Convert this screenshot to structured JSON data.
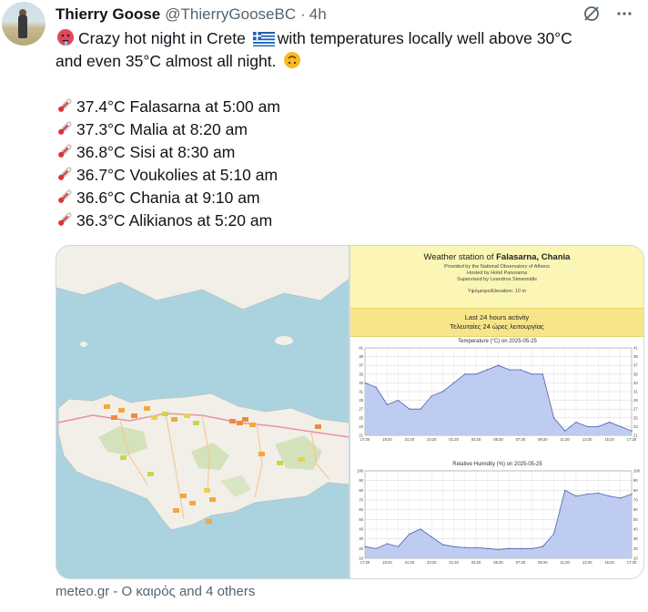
{
  "tweet": {
    "author_name": "Thierry Goose",
    "handle": "@ThierryGooseBC",
    "separator": "·",
    "time": "4h",
    "intro_line1": "Crazy hot night in Crete",
    "intro_line1b": "with temperatures locally well above 30°C",
    "intro_line2": "and even 35°C almost all night.",
    "readings": [
      "37.4°C Falasarna at 5:00 am",
      "37.3°C Malia at 8:20 am",
      "36.8°C Sisi at 8:30 am",
      "36.7°C Voukolies at 5:10 am",
      "36.6°C Chania at 9:10 am",
      "36.3°C Alikianos at 5:20 am"
    ],
    "footer": "meteo.gr - Ο καιρός and 4 others"
  },
  "icons": {
    "hot_face": "hot-face-emoji",
    "flag": "greece-flag-emoji",
    "upside_down": "upside-down-face-emoji",
    "thermometer": "thermometer-emoji",
    "grok": "grok-icon",
    "more": "more-icon"
  },
  "station": {
    "title_prefix": "Weather station of",
    "title_name": "Falasarna, Chania",
    "provided": "Provided by the National Observatory of Athens",
    "hosted": "Hosted by Hotel Panorama",
    "supervised": "Supervised by Leandros Simeonidis",
    "elevation": "Υψόμετρο/Elevation: 10 m",
    "last24_en": "Last 24 hours activity",
    "last24_gr": "Τελευταίες 24 ώρες λειτουργίας"
  },
  "colors": {
    "chart_fill": "#b8c6ef",
    "chart_line": "#4a5fae",
    "map_sea": "#aad3df",
    "map_land": "#f2efe9"
  },
  "chart_data": [
    {
      "type": "area",
      "title": "Temperature (°C) on 2025-05-25",
      "x": [
        "17:20",
        "18:20",
        "19:20",
        "20:20",
        "21:20",
        "22:20",
        "23:20",
        "00:20",
        "01:20",
        "02:20",
        "03:20",
        "04:20",
        "05:20",
        "06:20",
        "07:20",
        "08:20",
        "09:20",
        "10:20",
        "11:20",
        "12:20",
        "13:20",
        "14:20",
        "15:20",
        "16:20",
        "17:20"
      ],
      "y": [
        33,
        32,
        28,
        29,
        27,
        27,
        30,
        31,
        33,
        35,
        35,
        36,
        37,
        36,
        36,
        35,
        35,
        25,
        22,
        24,
        23,
        23,
        24,
        23,
        22
      ],
      "ylim": [
        21,
        41
      ],
      "ticks": [
        21,
        23,
        25,
        27,
        29,
        31,
        33,
        35,
        37,
        39,
        41
      ],
      "grid": true
    },
    {
      "type": "area",
      "title": "Relative Humidity (%) on 2025-05-25",
      "x": [
        "17:20",
        "18:20",
        "19:20",
        "20:20",
        "21:20",
        "22:20",
        "23:20",
        "00:20",
        "01:20",
        "02:20",
        "03:20",
        "04:20",
        "05:20",
        "06:20",
        "07:20",
        "08:20",
        "09:20",
        "10:20",
        "11:20",
        "12:20",
        "13:20",
        "14:20",
        "15:20",
        "16:20",
        "17:20"
      ],
      "y": [
        22,
        20,
        25,
        22,
        35,
        40,
        32,
        24,
        22,
        21,
        21,
        20,
        19,
        20,
        20,
        20,
        22,
        35,
        80,
        74,
        76,
        77,
        74,
        72,
        76
      ],
      "ylim": [
        10,
        100
      ],
      "ticks": [
        10,
        20,
        30,
        40,
        50,
        60,
        70,
        80,
        90,
        100
      ],
      "grid": true
    }
  ]
}
